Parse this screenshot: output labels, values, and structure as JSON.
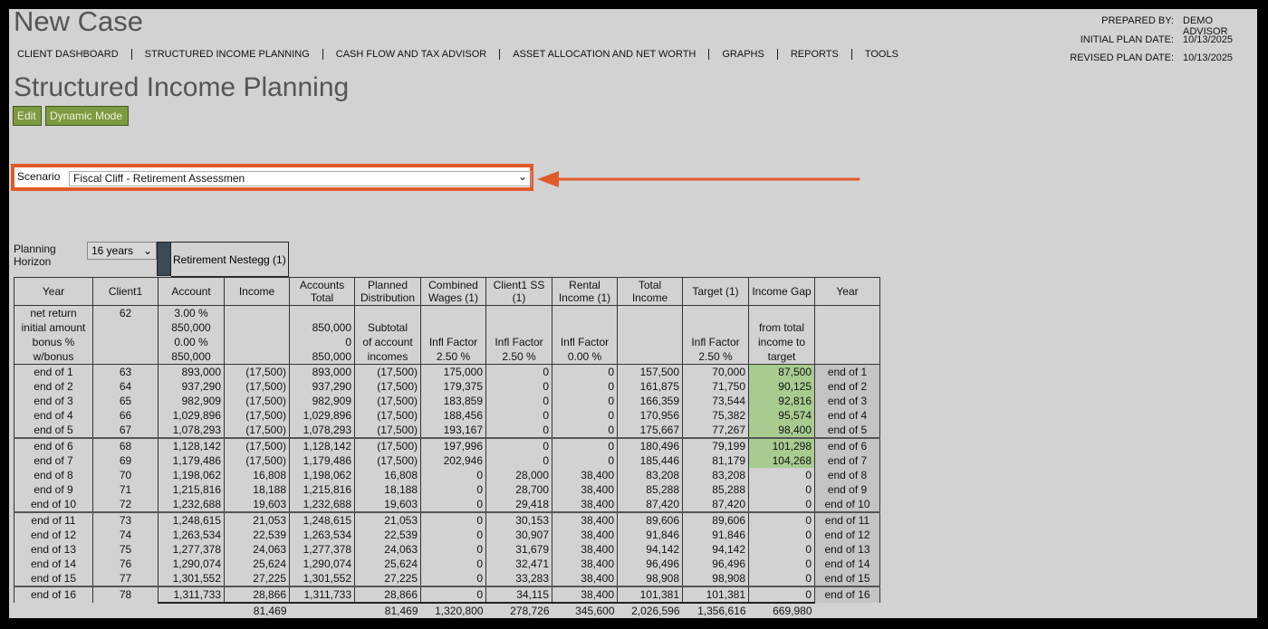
{
  "app_title": "New Case",
  "nav": [
    "CLIENT DASHBOARD",
    "STRUCTURED INCOME PLANNING",
    "CASH FLOW AND TAX ADVISOR",
    "ASSET ALLOCATION AND NET WORTH",
    "GRAPHS",
    "REPORTS",
    "TOOLS"
  ],
  "prepared": {
    "prepared_by_label": "PREPARED BY:",
    "prepared_by": "DEMO ADVISOR",
    "initial_label": "INITIAL PLAN DATE:",
    "initial": "10/13/2025",
    "revised_label": "REVISED PLAN DATE:",
    "revised": "10/13/2025"
  },
  "page_title": "Structured Income Planning",
  "buttons": {
    "edit": "Edit",
    "dynamic": "Dynamic Mode"
  },
  "scenario": {
    "label": "Scenario",
    "value": "Fiscal Cliff - Retirement Assessmen"
  },
  "planning": {
    "label_line1": "Planning",
    "label_line2": "Horizon",
    "value": "16 years",
    "nestegg": "Retirement Nestegg (1)"
  },
  "colors": {
    "green_button": "#7d9a3e",
    "highlight_orange": "#e05a2a",
    "factor_cell": "#e0a070",
    "gap_cell": "#a8cc90"
  },
  "table": {
    "headers": [
      "Year",
      "Client1",
      "Account",
      "Income",
      "Accounts Total",
      "Planned Distribution",
      "Combined Wages (1)",
      "Client1 SS (1)",
      "Rental Income (1)",
      "Total Income",
      "Target (1)",
      "Income Gap",
      "Year"
    ],
    "pre": {
      "year": [
        "net return",
        "initial amount",
        "bonus %",
        "w/bonus"
      ],
      "client1": "62",
      "account": [
        "3.00  %",
        "850,000",
        "0.00  %",
        "850,000"
      ],
      "accounts_total": [
        "",
        "850,000",
        "0",
        "850,000"
      ],
      "planned": [
        "",
        "Subtotal",
        "of account",
        "incomes"
      ],
      "infl_label": "Infl Factor",
      "wages_factor": "2.50  %",
      "ss_factor": "2.50  %",
      "rental_factor": "0.00  %",
      "target_factor": "2.50  %",
      "gap": [
        "",
        "from total",
        "income to",
        "target"
      ]
    },
    "rows": [
      [
        "end of 1",
        "63",
        "893,000",
        "(17,500)",
        "893,000",
        "(17,500)",
        "175,000",
        "0",
        "0",
        "157,500",
        "70,000",
        "87,500",
        "end of 1"
      ],
      [
        "end of 2",
        "64",
        "937,290",
        "(17,500)",
        "937,290",
        "(17,500)",
        "179,375",
        "0",
        "0",
        "161,875",
        "71,750",
        "90,125",
        "end of 2"
      ],
      [
        "end of 3",
        "65",
        "982,909",
        "(17,500)",
        "982,909",
        "(17,500)",
        "183,859",
        "0",
        "0",
        "166,359",
        "73,544",
        "92,816",
        "end of 3"
      ],
      [
        "end of 4",
        "66",
        "1,029,896",
        "(17,500)",
        "1,029,896",
        "(17,500)",
        "188,456",
        "0",
        "0",
        "170,956",
        "75,382",
        "95,574",
        "end of 4"
      ],
      [
        "end of 5",
        "67",
        "1,078,293",
        "(17,500)",
        "1,078,293",
        "(17,500)",
        "193,167",
        "0",
        "0",
        "175,667",
        "77,267",
        "98,400",
        "end of 5"
      ],
      [
        "end of 6",
        "68",
        "1,128,142",
        "(17,500)",
        "1,128,142",
        "(17,500)",
        "197,996",
        "0",
        "0",
        "180,496",
        "79,199",
        "101,298",
        "end of 6"
      ],
      [
        "end of 7",
        "69",
        "1,179,486",
        "(17,500)",
        "1,179,486",
        "(17,500)",
        "202,946",
        "0",
        "0",
        "185,446",
        "81,179",
        "104,268",
        "end of 7"
      ],
      [
        "end of 8",
        "70",
        "1,198,062",
        "16,808",
        "1,198,062",
        "16,808",
        "0",
        "28,000",
        "38,400",
        "83,208",
        "83,208",
        "0",
        "end of 8"
      ],
      [
        "end of 9",
        "71",
        "1,215,816",
        "18,188",
        "1,215,816",
        "18,188",
        "0",
        "28,700",
        "38,400",
        "85,288",
        "85,288",
        "0",
        "end of 9"
      ],
      [
        "end of 10",
        "72",
        "1,232,688",
        "19,603",
        "1,232,688",
        "19,603",
        "0",
        "29,418",
        "38,400",
        "87,420",
        "87,420",
        "0",
        "end of 10"
      ],
      [
        "end of 11",
        "73",
        "1,248,615",
        "21,053",
        "1,248,615",
        "21,053",
        "0",
        "30,153",
        "38,400",
        "89,606",
        "89,606",
        "0",
        "end of 11"
      ],
      [
        "end of 12",
        "74",
        "1,263,534",
        "22,539",
        "1,263,534",
        "22,539",
        "0",
        "30,907",
        "38,400",
        "91,846",
        "91,846",
        "0",
        "end of 12"
      ],
      [
        "end of 13",
        "75",
        "1,277,378",
        "24,063",
        "1,277,378",
        "24,063",
        "0",
        "31,679",
        "38,400",
        "94,142",
        "94,142",
        "0",
        "end of 13"
      ],
      [
        "end of 14",
        "76",
        "1,290,074",
        "25,624",
        "1,290,074",
        "25,624",
        "0",
        "32,471",
        "38,400",
        "96,496",
        "96,496",
        "0",
        "end of 14"
      ],
      [
        "end of 15",
        "77",
        "1,301,552",
        "27,225",
        "1,301,552",
        "27,225",
        "0",
        "33,283",
        "38,400",
        "98,908",
        "98,908",
        "0",
        "end of 15"
      ],
      [
        "end of 16",
        "78",
        "1,311,733",
        "28,866",
        "1,311,733",
        "28,866",
        "0",
        "34,115",
        "38,400",
        "101,381",
        "101,381",
        "0",
        "end of 16"
      ]
    ],
    "totals": [
      "",
      "",
      "",
      "81,469",
      "",
      "81,469",
      "1,320,800",
      "278,726",
      "345,600",
      "2,026,596",
      "1,356,616",
      "669,980",
      ""
    ]
  }
}
